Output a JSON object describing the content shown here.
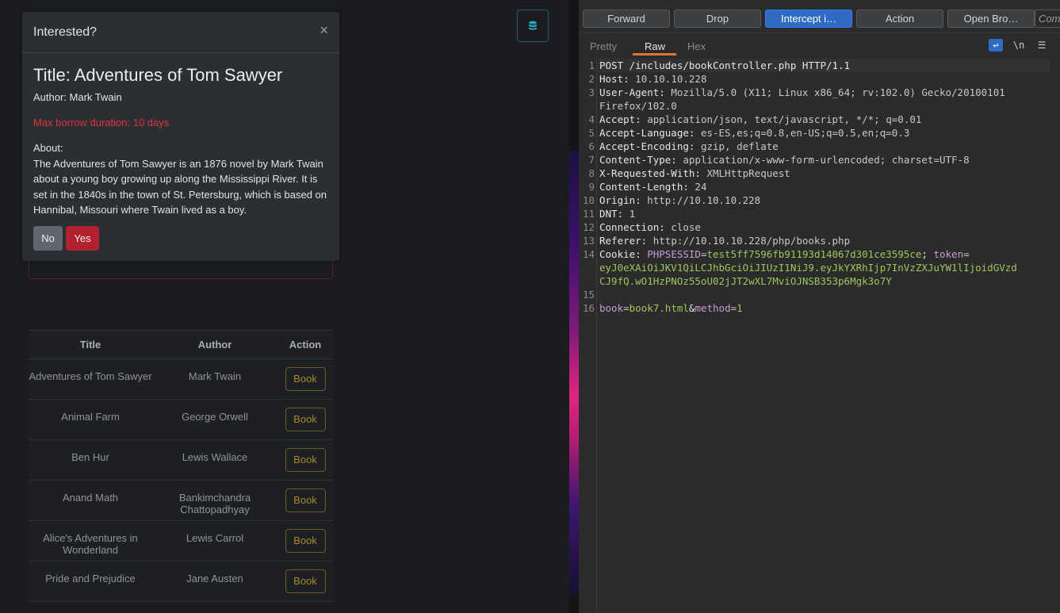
{
  "modal": {
    "header": "Interested?",
    "close": "×",
    "book_title": "Title: Adventures of Tom Sawyer",
    "author": "Author: Mark Twain",
    "max_borrow": "Max borrow duration: 10 days",
    "about_label": "About:",
    "about_text": "The Adventures of Tom Sawyer is an 1876 novel by Mark Twain about a young boy growing up along the Mississippi River. It is set in the 1840s in the town of St. Petersburg, which is based on Hannibal, Missouri where Twain lived as a boy.",
    "no_label": "No",
    "yes_label": "Yes"
  },
  "table": {
    "headers": [
      "Title",
      "Author",
      "Action"
    ],
    "rows": [
      {
        "title": "Adventures of Tom Sawyer",
        "author": "Mark Twain",
        "action": "Book"
      },
      {
        "title": "Animal Farm",
        "author": "George Orwell",
        "action": "Book"
      },
      {
        "title": "Ben Hur",
        "author": "Lewis Wallace",
        "action": "Book"
      },
      {
        "title": "Anand Math",
        "author": "Bankimchandra Chattopadhyay",
        "action": "Book"
      },
      {
        "title": "Alice's Adventures in Wonderland",
        "author": "Lewis Carrol",
        "action": "Book"
      },
      {
        "title": "Pride and Prejudice",
        "author": "Jane Austen",
        "action": "Book"
      }
    ]
  },
  "burp": {
    "toolbar": {
      "forward": "Forward",
      "drop": "Drop",
      "intercept": "Intercept i…",
      "action": "Action",
      "open_browser": "Open Bro…",
      "comment_placeholder": "Com"
    },
    "tabs": {
      "pretty": "Pretty",
      "raw": "Raw",
      "hex": "Hex"
    },
    "icons": {
      "wrap": "↩",
      "newline": "\\n",
      "menu": "☰"
    },
    "lines": [
      {
        "n": "1",
        "k": "POST /includes/bookController.php HTTP/1.1",
        "v": ""
      },
      {
        "n": "2",
        "k": "Host:",
        "v": " 10.10.10.228"
      },
      {
        "n": "3",
        "k": "User-Agent:",
        "v": " Mozilla/5.0 (X11; Linux x86_64; rv:102.0) Gecko/20100101"
      },
      {
        "n": "",
        "k": "",
        "v": "Firefox/102.0"
      },
      {
        "n": "4",
        "k": "Accept:",
        "v": " application/json, text/javascript, */*; q=0.01"
      },
      {
        "n": "5",
        "k": "Accept-Language:",
        "v": " es-ES,es;q=0.8,en-US;q=0.5,en;q=0.3"
      },
      {
        "n": "6",
        "k": "Accept-Encoding:",
        "v": " gzip, deflate"
      },
      {
        "n": "7",
        "k": "Content-Type:",
        "v": " application/x-www-form-urlencoded; charset=UTF-8"
      },
      {
        "n": "8",
        "k": "X-Requested-With:",
        "v": " XMLHttpRequest"
      },
      {
        "n": "9",
        "k": "Content-Length:",
        "v": " 24"
      },
      {
        "n": "10",
        "k": "Origin:",
        "v": " http://10.10.10.228"
      },
      {
        "n": "11",
        "k": "DNT:",
        "v": " 1"
      },
      {
        "n": "12",
        "k": "Connection:",
        "v": " close"
      },
      {
        "n": "13",
        "k": "Referer:",
        "v": " http://10.10.10.228/php/books.php"
      }
    ],
    "cookie": {
      "n": "14",
      "key": "Cookie:",
      "sess_name": "PHPSESSID",
      "sess_val": "test5ff7596fb91193d14067d301ce3595ce",
      "token_name": "token",
      "token_line1": "eyJ0eXAiOiJKV1QiLCJhbGciOiJIUzI1NiJ9.eyJkYXRhIjp7InVzZXJuYW1lIjoidGVzd",
      "token_line2": "CJ9fQ.wO1HzPNOz55oU02jJT2wXL7MviOJNSB353p6Mgk3o7Y"
    },
    "blank_n": "15",
    "body": {
      "n": "16",
      "k1": "book",
      "v1": "book7.html",
      "k2": "method",
      "v2": "1"
    }
  },
  "colors": {
    "accent_blue": "#2f6bc4",
    "burp_orange": "#e0743a",
    "danger_red": "#b0202f",
    "book_gold": "#a38a2c"
  }
}
